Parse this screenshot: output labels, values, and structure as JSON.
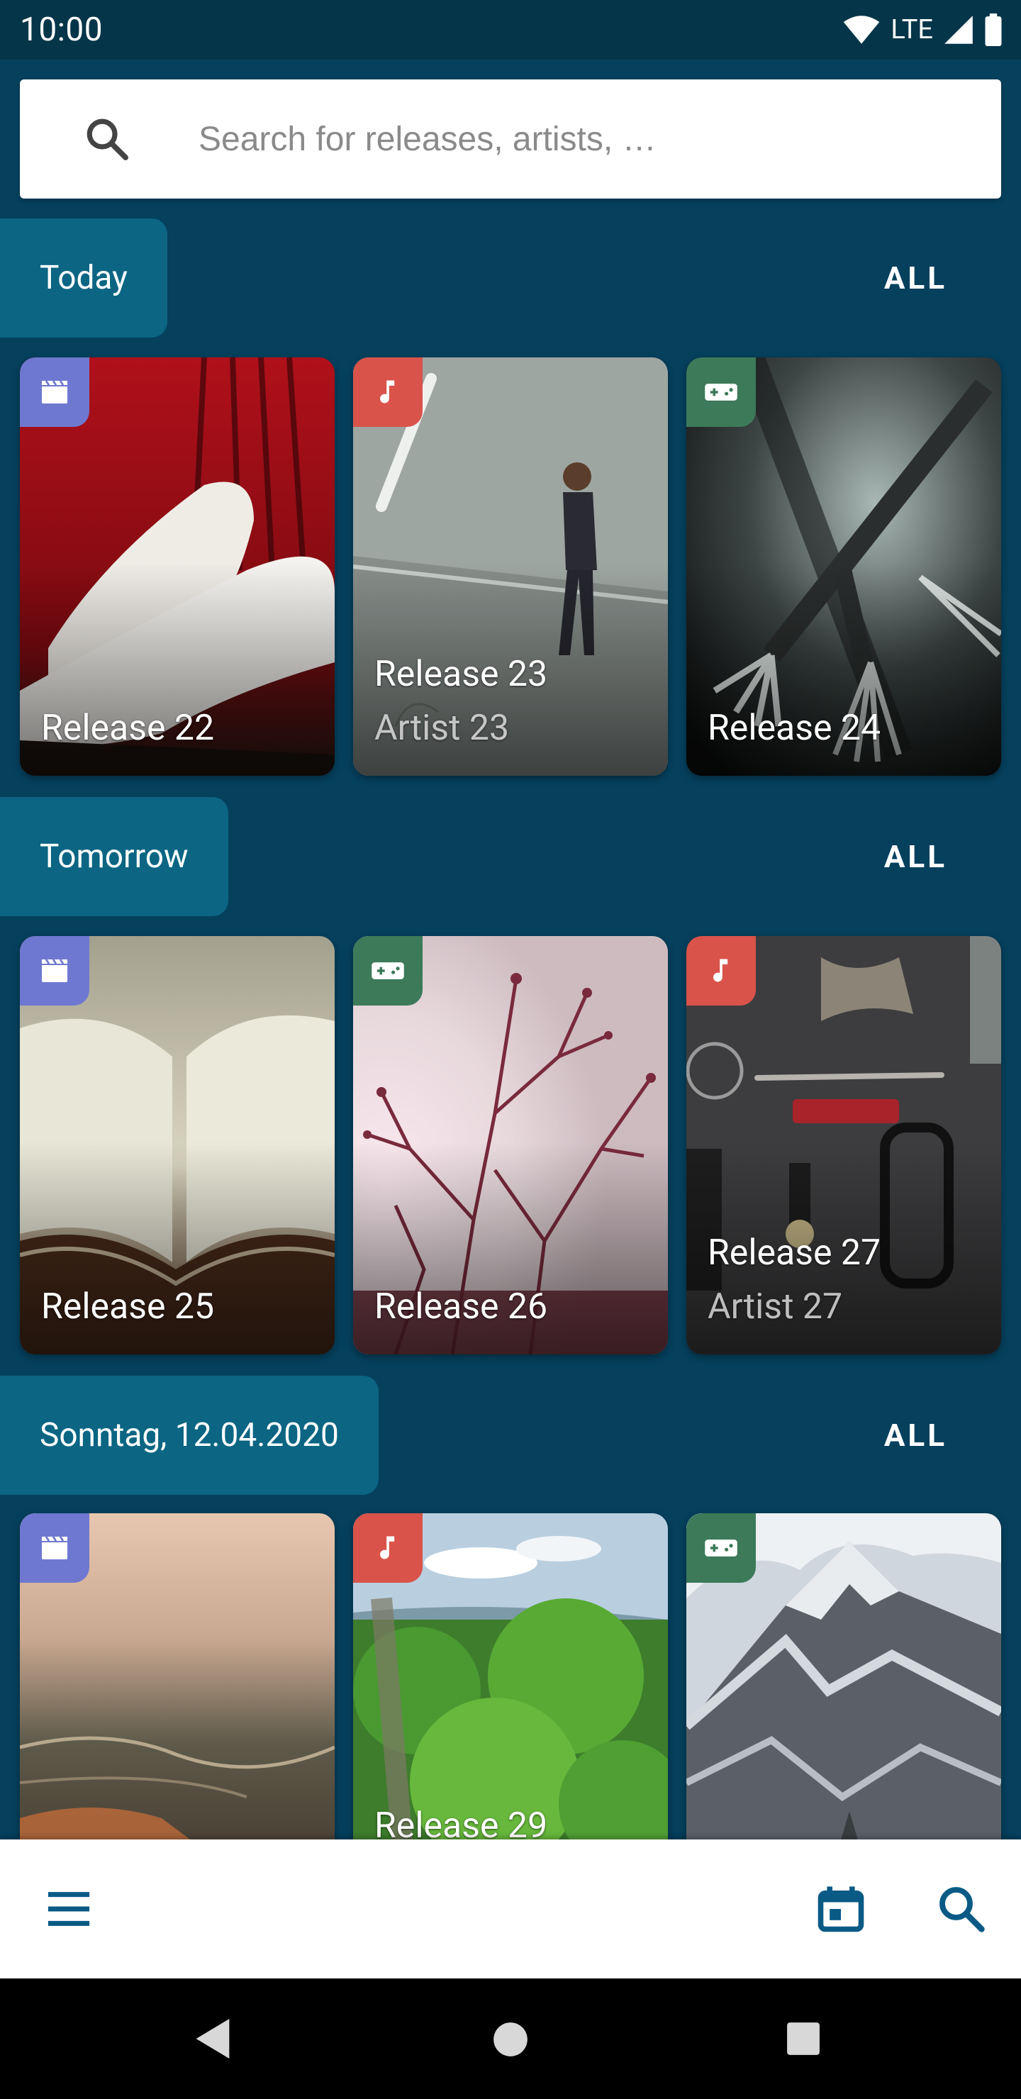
{
  "status_bar": {
    "time": "10:00",
    "network": "LTE"
  },
  "search": {
    "placeholder": "Search for releases, artists, …"
  },
  "sections": [
    {
      "label": "Today",
      "all_label": "ALL",
      "cards": [
        {
          "badge": "movie",
          "badge_icon": "clapperboard-icon",
          "title": "Release 22",
          "artist": ""
        },
        {
          "badge": "music",
          "badge_icon": "music-note-icon",
          "title": "Release 23",
          "artist": "Artist 23"
        },
        {
          "badge": "game",
          "badge_icon": "gamepad-icon",
          "title": "Release 24",
          "artist": ""
        }
      ]
    },
    {
      "label": "Tomorrow",
      "all_label": "ALL",
      "cards": [
        {
          "badge": "movie",
          "badge_icon": "clapperboard-icon",
          "title": "Release 25",
          "artist": ""
        },
        {
          "badge": "game",
          "badge_icon": "gamepad-icon",
          "title": "Release 26",
          "artist": ""
        },
        {
          "badge": "music",
          "badge_icon": "music-note-icon",
          "title": "Release 27",
          "artist": "Artist 27"
        }
      ]
    },
    {
      "label": "Sonntag, 12.04.2020",
      "all_label": "ALL",
      "cards": [
        {
          "badge": "movie",
          "badge_icon": "clapperboard-icon",
          "title": "",
          "artist": ""
        },
        {
          "badge": "music",
          "badge_icon": "music-note-icon",
          "title": "Release 29",
          "artist": ""
        },
        {
          "badge": "game",
          "badge_icon": "gamepad-icon",
          "title": "",
          "artist": ""
        }
      ]
    }
  ],
  "bottom_bar": {
    "icons": [
      "menu-icon",
      "calendar-icon",
      "search-icon"
    ]
  },
  "colors": {
    "background": "#05405d",
    "status_bar": "#053549",
    "section_chip": "#0b6583",
    "badge_movie": "#6f78d0",
    "badge_music": "#d9534a",
    "badge_game": "#3c7a5a",
    "icon_blue": "#0a5a86"
  }
}
